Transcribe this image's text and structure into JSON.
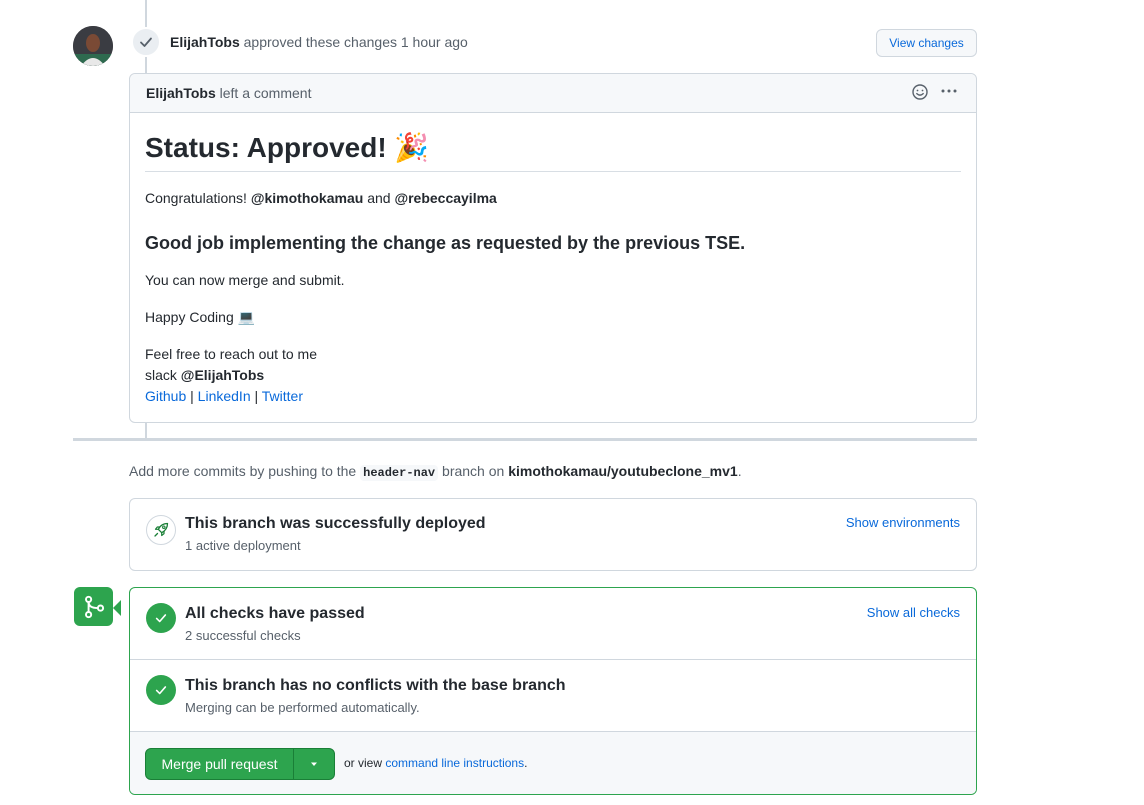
{
  "review": {
    "author": "ElijahTobs",
    "action": "approved these changes",
    "time": "1 hour ago",
    "view_changes_label": "View changes"
  },
  "comment": {
    "author": "ElijahTobs",
    "action": "left a comment",
    "heading": "Status: Approved! 🎉",
    "congrats_prefix": "Congratulations!",
    "mention1": "@kimothokamau",
    "and_word": "and",
    "mention2": "@rebeccayilma",
    "subheading": "Good job implementing the change as requested by the previous TSE.",
    "merge_text": "You can now merge and submit.",
    "happy_coding": "Happy Coding 💻",
    "reach_out": "Feel free to reach out to me",
    "slack_prefix": "slack",
    "slack_handle": "@ElijahTobs",
    "links": {
      "github": "Github",
      "linkedin": "LinkedIn",
      "twitter": "Twitter",
      "separator": "|"
    }
  },
  "push_note": {
    "prefix": "Add more commits by pushing to the",
    "branch": "header-nav",
    "middle": "branch on",
    "repo": "kimothokamau/youtubeclone_mv1",
    "suffix": "."
  },
  "deploy": {
    "title": "This branch was successfully deployed",
    "subtitle": "1 active deployment",
    "link": "Show environments",
    "icon": "rocket-icon"
  },
  "checks": {
    "title": "All checks have passed",
    "subtitle": "2 successful checks",
    "link": "Show all checks"
  },
  "conflicts": {
    "title": "This branch has no conflicts with the base branch",
    "subtitle": "Merging can be performed automatically."
  },
  "merge": {
    "button_label": "Merge pull request",
    "or_view": "or view",
    "cli_link": "command line instructions",
    "period": "."
  },
  "colors": {
    "green": "#2da44e",
    "link_blue": "#0969da",
    "border": "#d0d7de"
  }
}
